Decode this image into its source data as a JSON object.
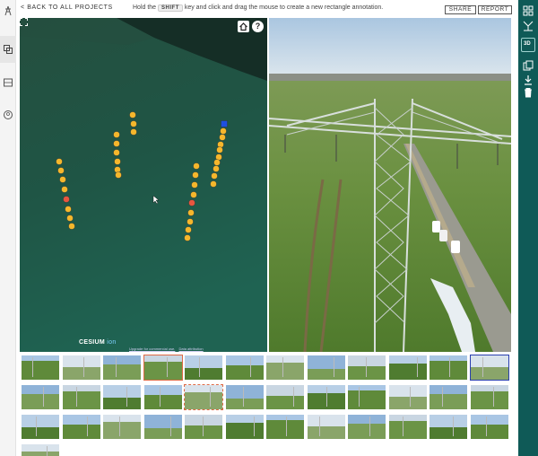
{
  "topbar": {
    "back_label": "< BACK TO ALL PROJECTS",
    "hint_prefix": "Hold the",
    "hint_key": "SHIFT",
    "hint_suffix": "key and click and drag the mouse to create a new rectangle annotation.",
    "share_label": "SHARE",
    "report_label": "REPORT"
  },
  "left_rail": {
    "icons": [
      "tower-icon",
      "layers-icon",
      "image-icon",
      "account-icon"
    ]
  },
  "map": {
    "home_icon": "home-icon",
    "help_label": "?",
    "attribution_logo": "CESIUM",
    "attribution_ion": "ion",
    "upgrade_link": "Upgrade for commercial use.",
    "data_link": "Data attribution",
    "marker_colors": {
      "normal": "#f5b72c",
      "flagged": "#e8563f",
      "selected": "#1e4fe0"
    }
  },
  "right_panel": {
    "icons": [
      "tree-network-icon",
      "3d-view-icon",
      "copy-icon",
      "download-icon",
      "trash-icon"
    ],
    "label_3d": "3D"
  },
  "thumbnails": {
    "rows": 4,
    "per_row": 12,
    "selected_index": 3,
    "dashed_index": 16,
    "blue_index": 11
  },
  "colors": {
    "accent": "#0f5a57",
    "selection": "#e06a45",
    "active_blue": "#2a3fb0"
  }
}
